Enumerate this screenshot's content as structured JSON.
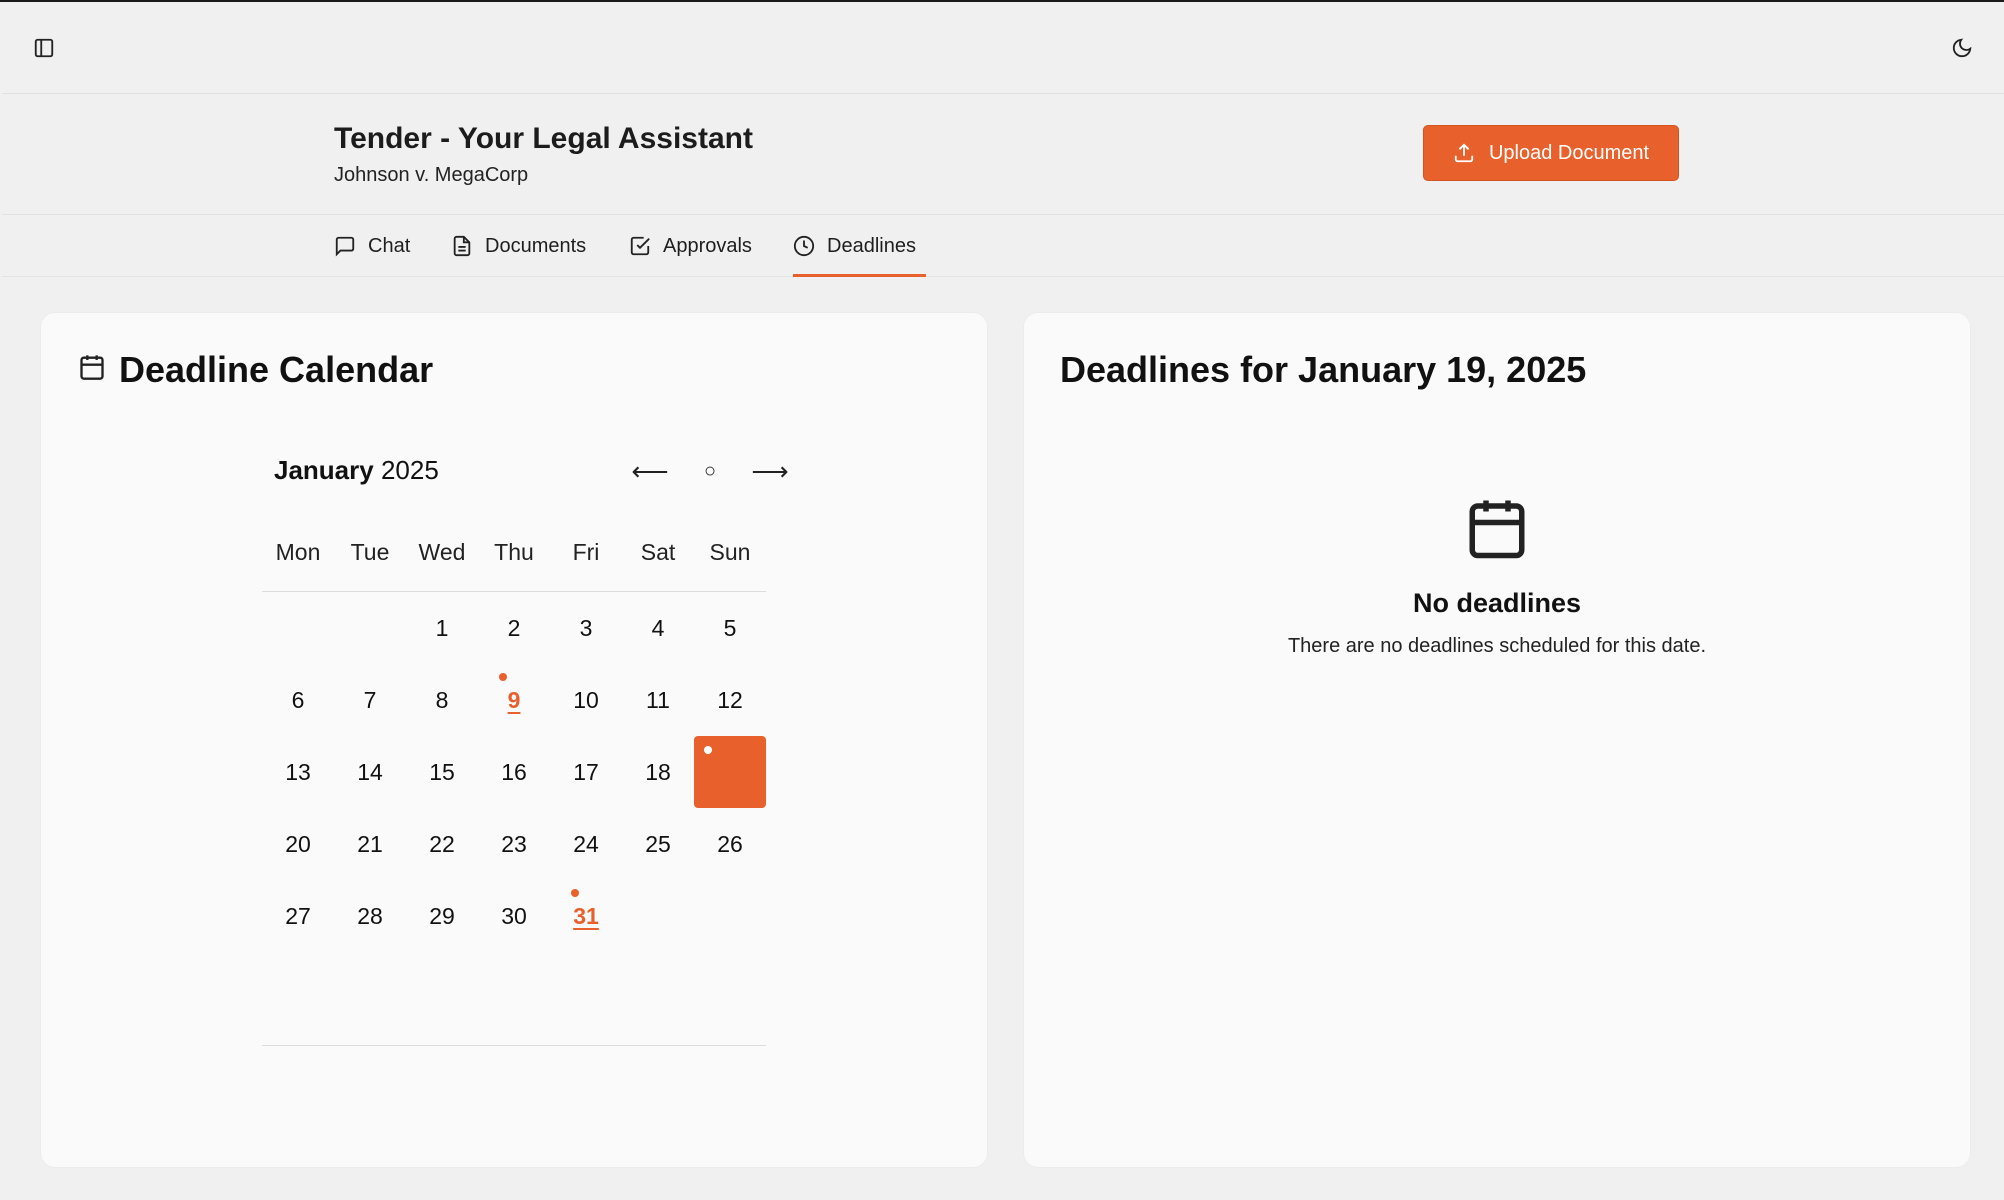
{
  "topbar": {
    "sidebar_icon": "sidebar-toggle-icon",
    "theme_icon": "moon-icon"
  },
  "header": {
    "title": "Tender - Your Legal Assistant",
    "case": "Johnson v. MegaCorp",
    "upload_label": "Upload Document"
  },
  "tabs": [
    {
      "label": "Chat",
      "icon": "chat-icon"
    },
    {
      "label": "Documents",
      "icon": "document-icon"
    },
    {
      "label": "Approvals",
      "icon": "check-square-icon"
    },
    {
      "label": "Deadlines",
      "icon": "clock-icon",
      "active": true
    }
  ],
  "calendar": {
    "title": "Deadline Calendar",
    "month": "January",
    "year": "2025",
    "prev": "⟵",
    "today": "○",
    "next": "⟶",
    "weekdays": [
      "Mon",
      "Tue",
      "Wed",
      "Thu",
      "Fri",
      "Sat",
      "Sun"
    ],
    "first_weekday_index": 2,
    "days_in_month": 31,
    "deadline_days": [
      9,
      19,
      31
    ],
    "selected_day": 19
  },
  "detail": {
    "title": "Deadlines for January 19, 2025",
    "empty_title": "No deadlines",
    "empty_desc": "There are no deadlines scheduled for this date."
  },
  "colors": {
    "accent": "#e8602c"
  }
}
